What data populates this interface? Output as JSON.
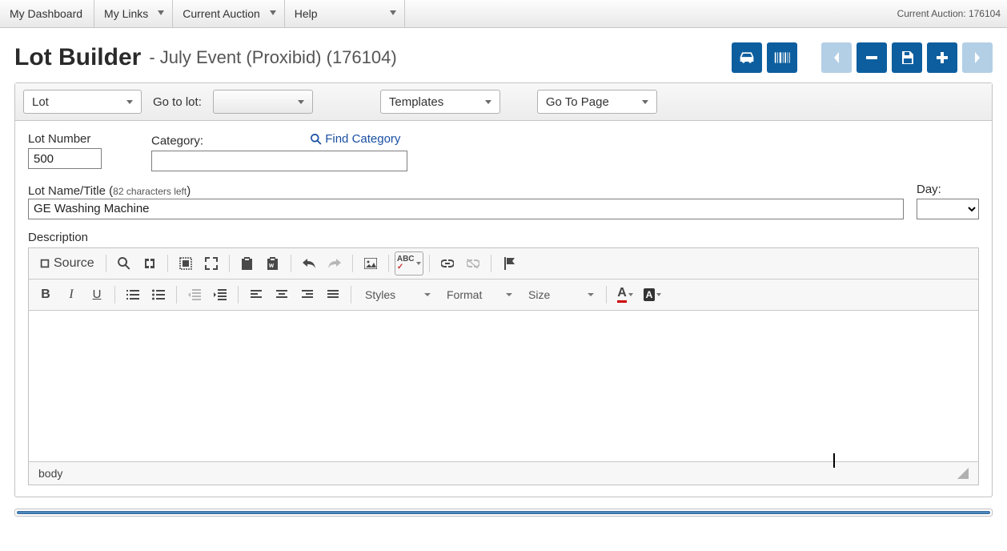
{
  "topbar": {
    "items": [
      {
        "label": "My Dashboard",
        "caret": false
      },
      {
        "label": "My Links",
        "caret": true
      },
      {
        "label": "Current Auction",
        "caret": true
      },
      {
        "label": "Help",
        "caret": true
      }
    ],
    "current_auction_label": "Current Auction: 176104"
  },
  "header": {
    "title": "Lot Builder",
    "subtitle": "- July Event (Proxibid) (176104)"
  },
  "toolstrip": {
    "lot_label": "Lot",
    "go_to_lot_label": "Go to lot:",
    "templates_label": "Templates",
    "go_to_page_label": "Go To Page"
  },
  "form": {
    "lot_number_label": "Lot Number",
    "lot_number_value": "500",
    "category_label": "Category:",
    "category_value": "",
    "find_category_label": "Find Category",
    "lot_title_label": "Lot Name/Title (",
    "lot_title_remaining": "82 characters left",
    "lot_title_close": ")",
    "lot_title_value": "GE Washing Machine",
    "day_label": "Day:",
    "description_label": "Description"
  },
  "editor": {
    "source_label": "Source",
    "styles_label": "Styles",
    "format_label": "Format",
    "size_label": "Size",
    "footer_path": "body"
  }
}
